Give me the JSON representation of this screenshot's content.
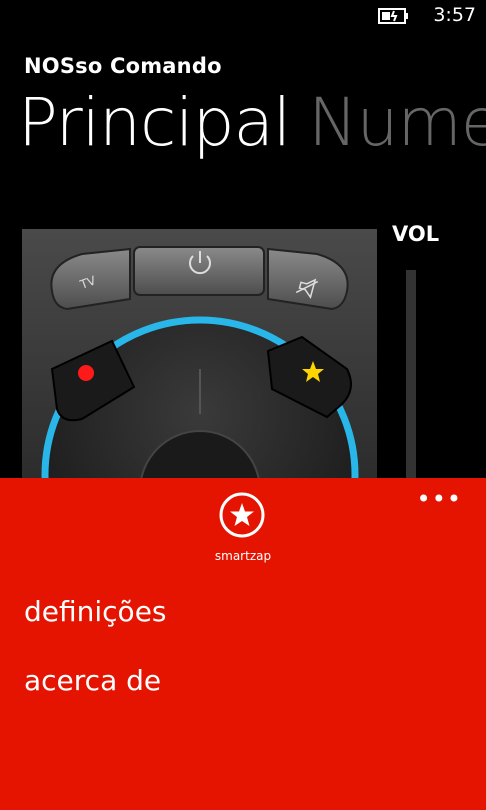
{
  "status": {
    "time": "3:57"
  },
  "app": {
    "title": "NOSso Comando"
  },
  "pivot": {
    "items": [
      "Principal",
      "Nume"
    ]
  },
  "volume": {
    "label": "VOL"
  },
  "remote": {
    "buttons": [
      "TV",
      "power",
      "mute",
      "record",
      "smartzap-star"
    ]
  },
  "app_bar": {
    "more": "•••",
    "smartzap_label": "smartzap",
    "menu": [
      "definições",
      "acerca de"
    ]
  },
  "colors": {
    "accent": "#e51400",
    "ring": "#29b6e8",
    "star": "#ffd400",
    "record": "#ff1a1a"
  }
}
